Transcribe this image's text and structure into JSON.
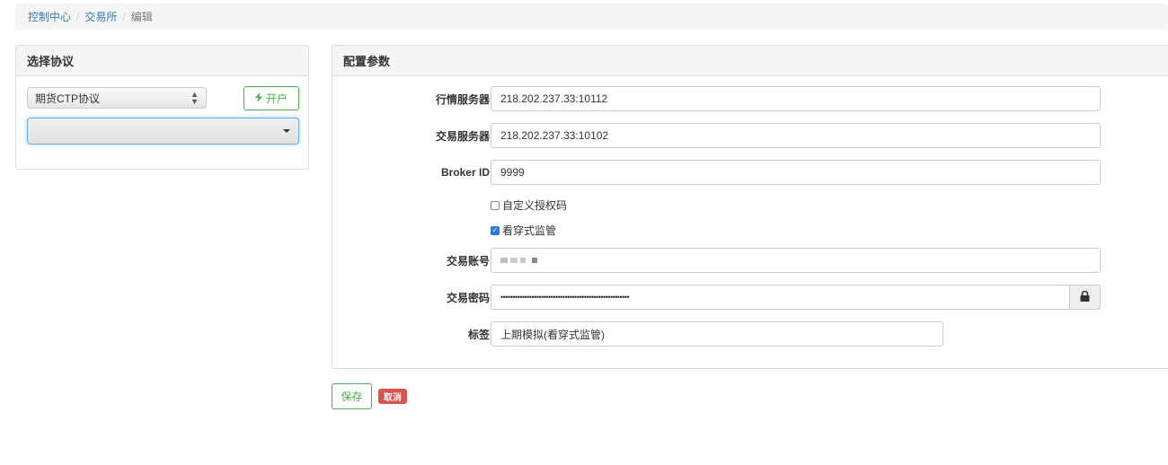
{
  "breadcrumb": {
    "items": [
      "控制中心",
      "交易所"
    ],
    "separator": "/",
    "current": "编辑"
  },
  "left_panel": {
    "title": "选择协议",
    "protocol_select": {
      "value": "期货CTP协议"
    },
    "open_button_label": "开户",
    "second_select": {
      "value": ""
    }
  },
  "right_panel": {
    "title": "配置参数",
    "fields": {
      "market_server": {
        "label": "行情服务器",
        "value": "218.202.237.33:10112"
      },
      "trade_server": {
        "label": "交易服务器",
        "value": "218.202.237.33:10102"
      },
      "broker_id": {
        "label": "Broker ID",
        "value": "9999"
      },
      "custom_auth": {
        "label": "自定义授权码",
        "checked": false
      },
      "penetration": {
        "label": "看穿式监管",
        "checked": true
      },
      "account": {
        "label": "交易账号"
      },
      "password": {
        "label": "交易密码",
        "value": "••••••••••••••••••••••••••••••••••••••••••••••••••••••"
      },
      "tag": {
        "label": "标签",
        "value": "上期模拟(看穿式监管)"
      }
    }
  },
  "actions": {
    "save_label": "保存",
    "cancel_label": "取消"
  },
  "colors": {
    "success": "#4cae4c",
    "danger": "#d9534f",
    "link": "#337ab7"
  }
}
